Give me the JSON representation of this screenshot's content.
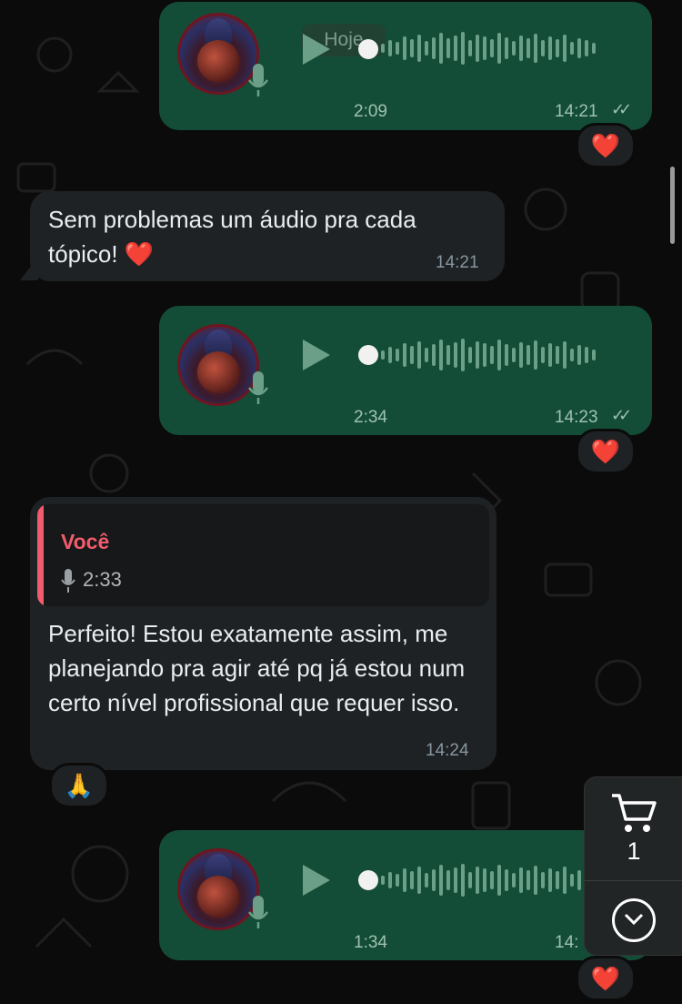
{
  "chat": {
    "date_badge": "Hoje",
    "messages": [
      {
        "kind": "voice_out",
        "duration": "2:09",
        "time": "14:21",
        "ticks": "✓✓",
        "reaction": "❤️"
      },
      {
        "kind": "text_in",
        "text": "Sem problemas um áudio pra cada tópico! ❤️",
        "time": "14:21"
      },
      {
        "kind": "voice_out",
        "duration": "2:34",
        "time": "14:23",
        "ticks": "✓✓",
        "reaction": "❤️"
      },
      {
        "kind": "reply_in",
        "quote_author": "Você",
        "quote_duration": "2:33",
        "text": "Perfeito! Estou exatamente assim, me planejando pra agir até pq já estou num certo nível profissional que requer isso.",
        "time": "14:24",
        "reaction": "🙏"
      },
      {
        "kind": "voice_out",
        "duration": "1:34",
        "time": "14:",
        "reaction": "❤️"
      }
    ]
  },
  "side_panel": {
    "cart_count": "1",
    "cart_icon": "cart-icon",
    "scroll_icon": "chevron-down-icon"
  },
  "colors": {
    "outgoing_bubble": "#134d37",
    "incoming_bubble": "#1f2224",
    "background": "#0b0b0b",
    "quote_accent": "#f15c6d",
    "waveform": "#6c9f87"
  }
}
